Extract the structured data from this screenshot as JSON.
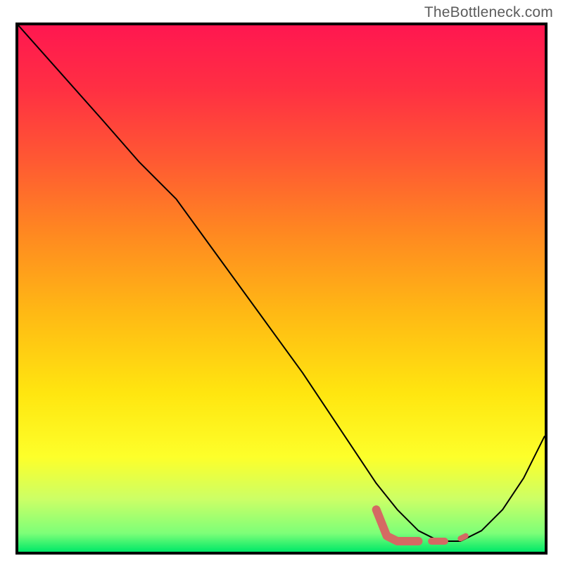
{
  "watermark": "TheBottleneck.com",
  "gradient_stops": [
    {
      "offset": 0.0,
      "color": "#ff1750"
    },
    {
      "offset": 0.12,
      "color": "#ff2f43"
    },
    {
      "offset": 0.26,
      "color": "#ff5a32"
    },
    {
      "offset": 0.4,
      "color": "#ff8a20"
    },
    {
      "offset": 0.55,
      "color": "#ffba14"
    },
    {
      "offset": 0.7,
      "color": "#ffe610"
    },
    {
      "offset": 0.82,
      "color": "#fdff2a"
    },
    {
      "offset": 0.9,
      "color": "#ccff66"
    },
    {
      "offset": 0.965,
      "color": "#7dff78"
    },
    {
      "offset": 1.0,
      "color": "#00e868"
    }
  ],
  "chart_data": {
    "type": "line",
    "title": "",
    "xlabel": "",
    "ylabel": "",
    "xlim": [
      0,
      100
    ],
    "ylim": [
      0,
      100
    ],
    "series": [
      {
        "name": "bottleneck-curve",
        "color": "#000000",
        "width": 2,
        "x": [
          0,
          8,
          16,
          23,
          30,
          38,
          46,
          54,
          62,
          68,
          72,
          76,
          80,
          84,
          88,
          92,
          96,
          100
        ],
        "y": [
          100,
          91,
          82,
          74,
          67,
          56,
          45,
          34,
          22,
          13,
          8,
          4,
          2,
          2,
          4,
          8,
          14,
          22
        ]
      },
      {
        "name": "highlight-segment",
        "color": "#d46a63",
        "width": 12,
        "linecap": "round",
        "x": [
          68,
          70,
          72,
          76
        ],
        "y": [
          8,
          3,
          2,
          2
        ]
      },
      {
        "name": "highlight-dash1",
        "color": "#d46a63",
        "width": 10,
        "linecap": "round",
        "x": [
          78.5,
          81
        ],
        "y": [
          2,
          2
        ]
      },
      {
        "name": "highlight-dot",
        "color": "#d46a63",
        "width": 8,
        "linecap": "round",
        "x": [
          84,
          85
        ],
        "y": [
          2.5,
          3
        ]
      }
    ]
  }
}
